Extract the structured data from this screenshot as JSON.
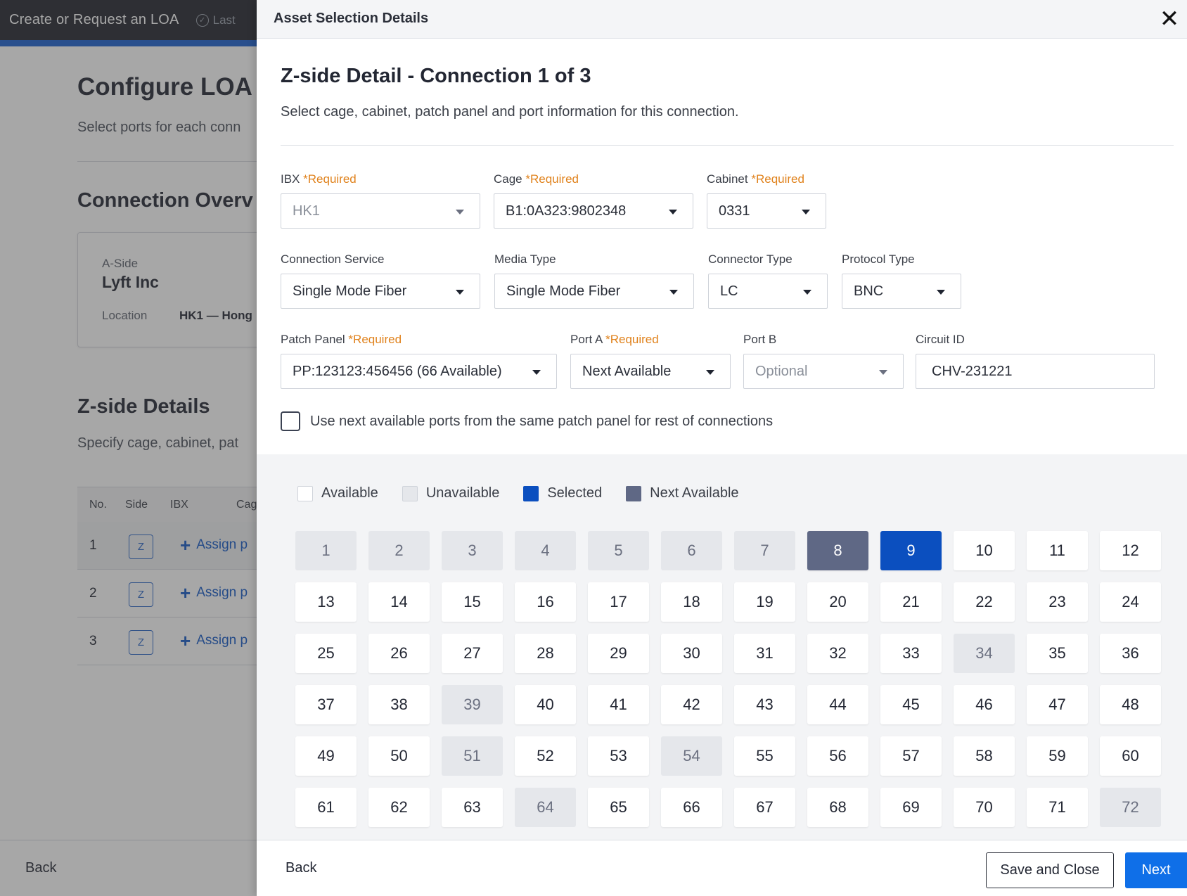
{
  "background": {
    "app_title": "Create or Request an LOA",
    "saved_text": "Last",
    "page_title": "Configure LOA",
    "page_subtitle": "Select ports for each conn",
    "overview_title": "Connection Overv",
    "aside": {
      "label": "A-Side",
      "name": "Lyft Inc",
      "location_label": "Location",
      "location_value": "HK1 — Hong"
    },
    "zside_title": "Z-side Details",
    "zside_subtitle": "Specify cage, cabinet, pat",
    "table": {
      "headers": [
        "No.",
        "Side",
        "IBX",
        "Cag"
      ],
      "rows": [
        {
          "no": "1",
          "side": "Z",
          "action": "Assign p"
        },
        {
          "no": "2",
          "side": "Z",
          "action": "Assign p"
        },
        {
          "no": "3",
          "side": "Z",
          "action": "Assign p"
        }
      ]
    },
    "back_label": "Back"
  },
  "panel": {
    "title": "Asset Selection Details",
    "detail_title": "Z-side Detail - Connection 1 of 3",
    "detail_subtitle": "Select cage, cabinet, patch panel and port information for this connection.",
    "required_tag": "*Required",
    "fields": {
      "ibx": {
        "label": "IBX",
        "value": "HK1"
      },
      "cage": {
        "label": "Cage",
        "value": "B1:0A323:9802348"
      },
      "cabinet": {
        "label": "Cabinet",
        "value": "0331"
      },
      "connection_service": {
        "label": "Connection Service",
        "value": "Single Mode Fiber"
      },
      "media_type": {
        "label": "Media Type",
        "value": "Single Mode Fiber"
      },
      "connector_type": {
        "label": "Connector Type",
        "value": "LC"
      },
      "protocol_type": {
        "label": "Protocol Type",
        "value": "BNC"
      },
      "patch_panel": {
        "label": "Patch Panel",
        "value": "PP:123123:456456 (66 Available)"
      },
      "port_a": {
        "label": "Port A",
        "value": "Next Available"
      },
      "port_b": {
        "label": "Port B",
        "placeholder": "Optional"
      },
      "circuit_id": {
        "label": "Circuit ID",
        "value": "CHV-231221"
      }
    },
    "checkbox_label": "Use next available ports from the same patch panel for rest of connections",
    "legend": {
      "available": "Available",
      "unavailable": "Unavailable",
      "selected": "Selected",
      "next_available": "Next Available"
    },
    "colors": {
      "selected": "#0b4fbf",
      "next_available": "#5f6885",
      "unavailable": "#e5e7eb",
      "required": "#e0821c",
      "primary": "#0f6fe8"
    },
    "ports": {
      "count": 72,
      "unavailable": [
        1,
        2,
        3,
        4,
        5,
        6,
        7,
        34,
        39,
        51,
        54,
        64,
        72
      ],
      "next_available": [
        8
      ],
      "selected": [
        9
      ]
    },
    "footer": {
      "back_label": "Back",
      "save_close_label": "Save and Close",
      "next_label": "Next"
    }
  }
}
